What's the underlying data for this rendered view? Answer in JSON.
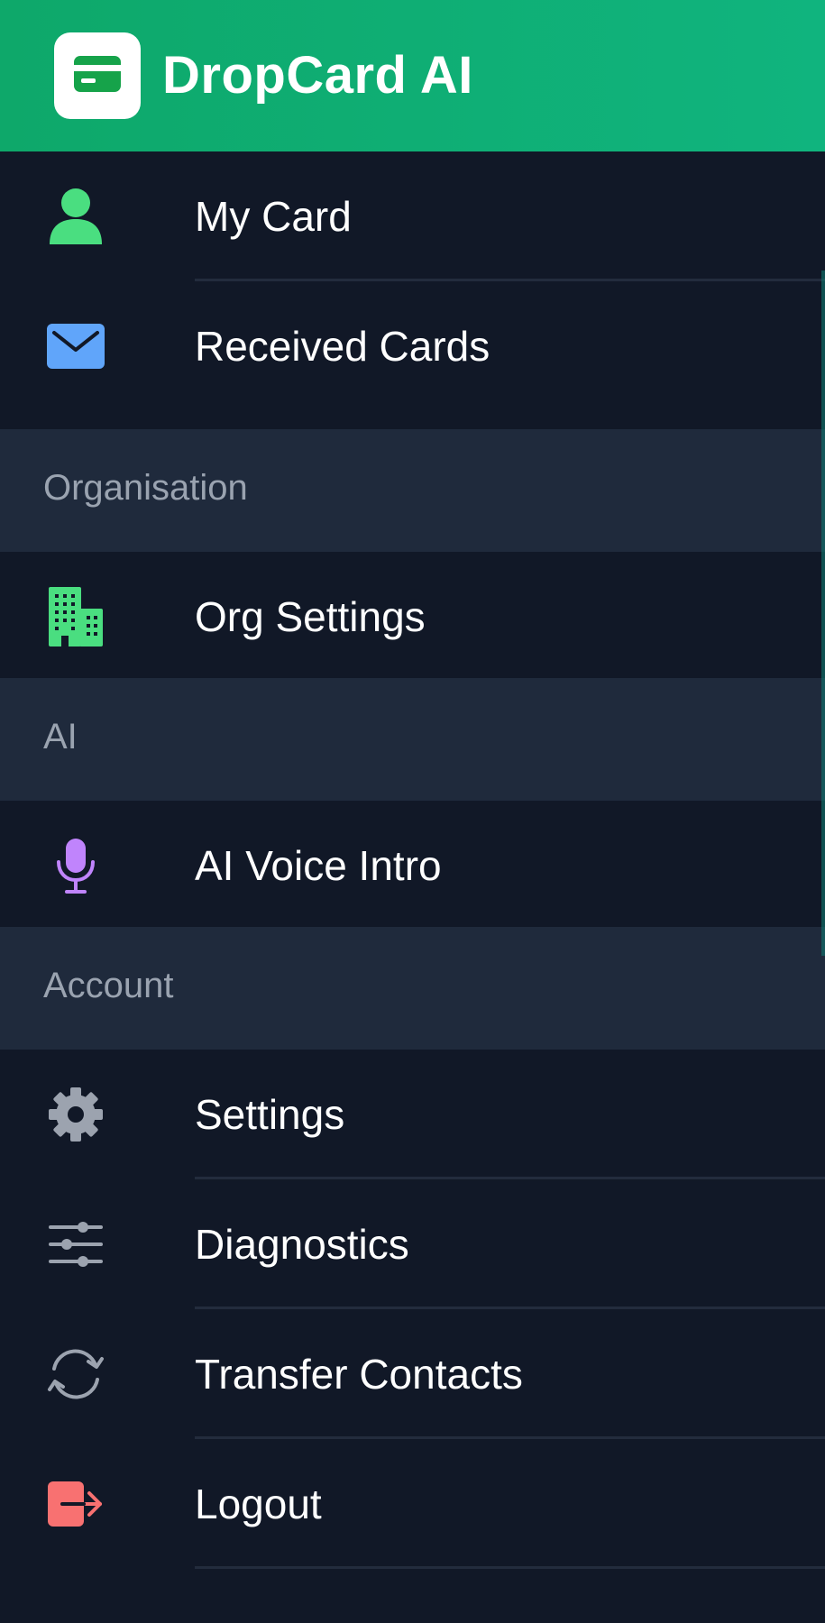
{
  "app": {
    "title": "DropCard AI",
    "logo_icon": "credit-card-icon"
  },
  "colors": {
    "header_start": "#0ea86a",
    "header_end": "#10b47e",
    "drawer_bg": "#111827",
    "section_bg": "#1f2a3c",
    "section_text": "#9aa3b0",
    "item_text": "#ffffff",
    "green_icon": "#4ade80",
    "blue_icon": "#60a5fa",
    "purple_icon": "#c084fc",
    "gray_icon": "#9ca3af",
    "red_icon": "#f87171"
  },
  "menu": {
    "my_card": {
      "label": "My Card",
      "icon": "person-icon"
    },
    "received_cards": {
      "label": "Received Cards",
      "icon": "envelope-icon"
    },
    "organisation_header": "Organisation",
    "org_settings": {
      "label": "Org Settings",
      "icon": "building-icon"
    },
    "ai_header": "AI",
    "ai_voice_intro": {
      "label": "AI Voice Intro",
      "icon": "microphone-icon"
    },
    "account_header": "Account",
    "settings": {
      "label": "Settings",
      "icon": "gear-icon"
    },
    "diagnostics": {
      "label": "Diagnostics",
      "icon": "sliders-icon"
    },
    "transfer_contacts": {
      "label": "Transfer Contacts",
      "icon": "sync-icon"
    },
    "logout": {
      "label": "Logout",
      "icon": "logout-icon"
    }
  }
}
